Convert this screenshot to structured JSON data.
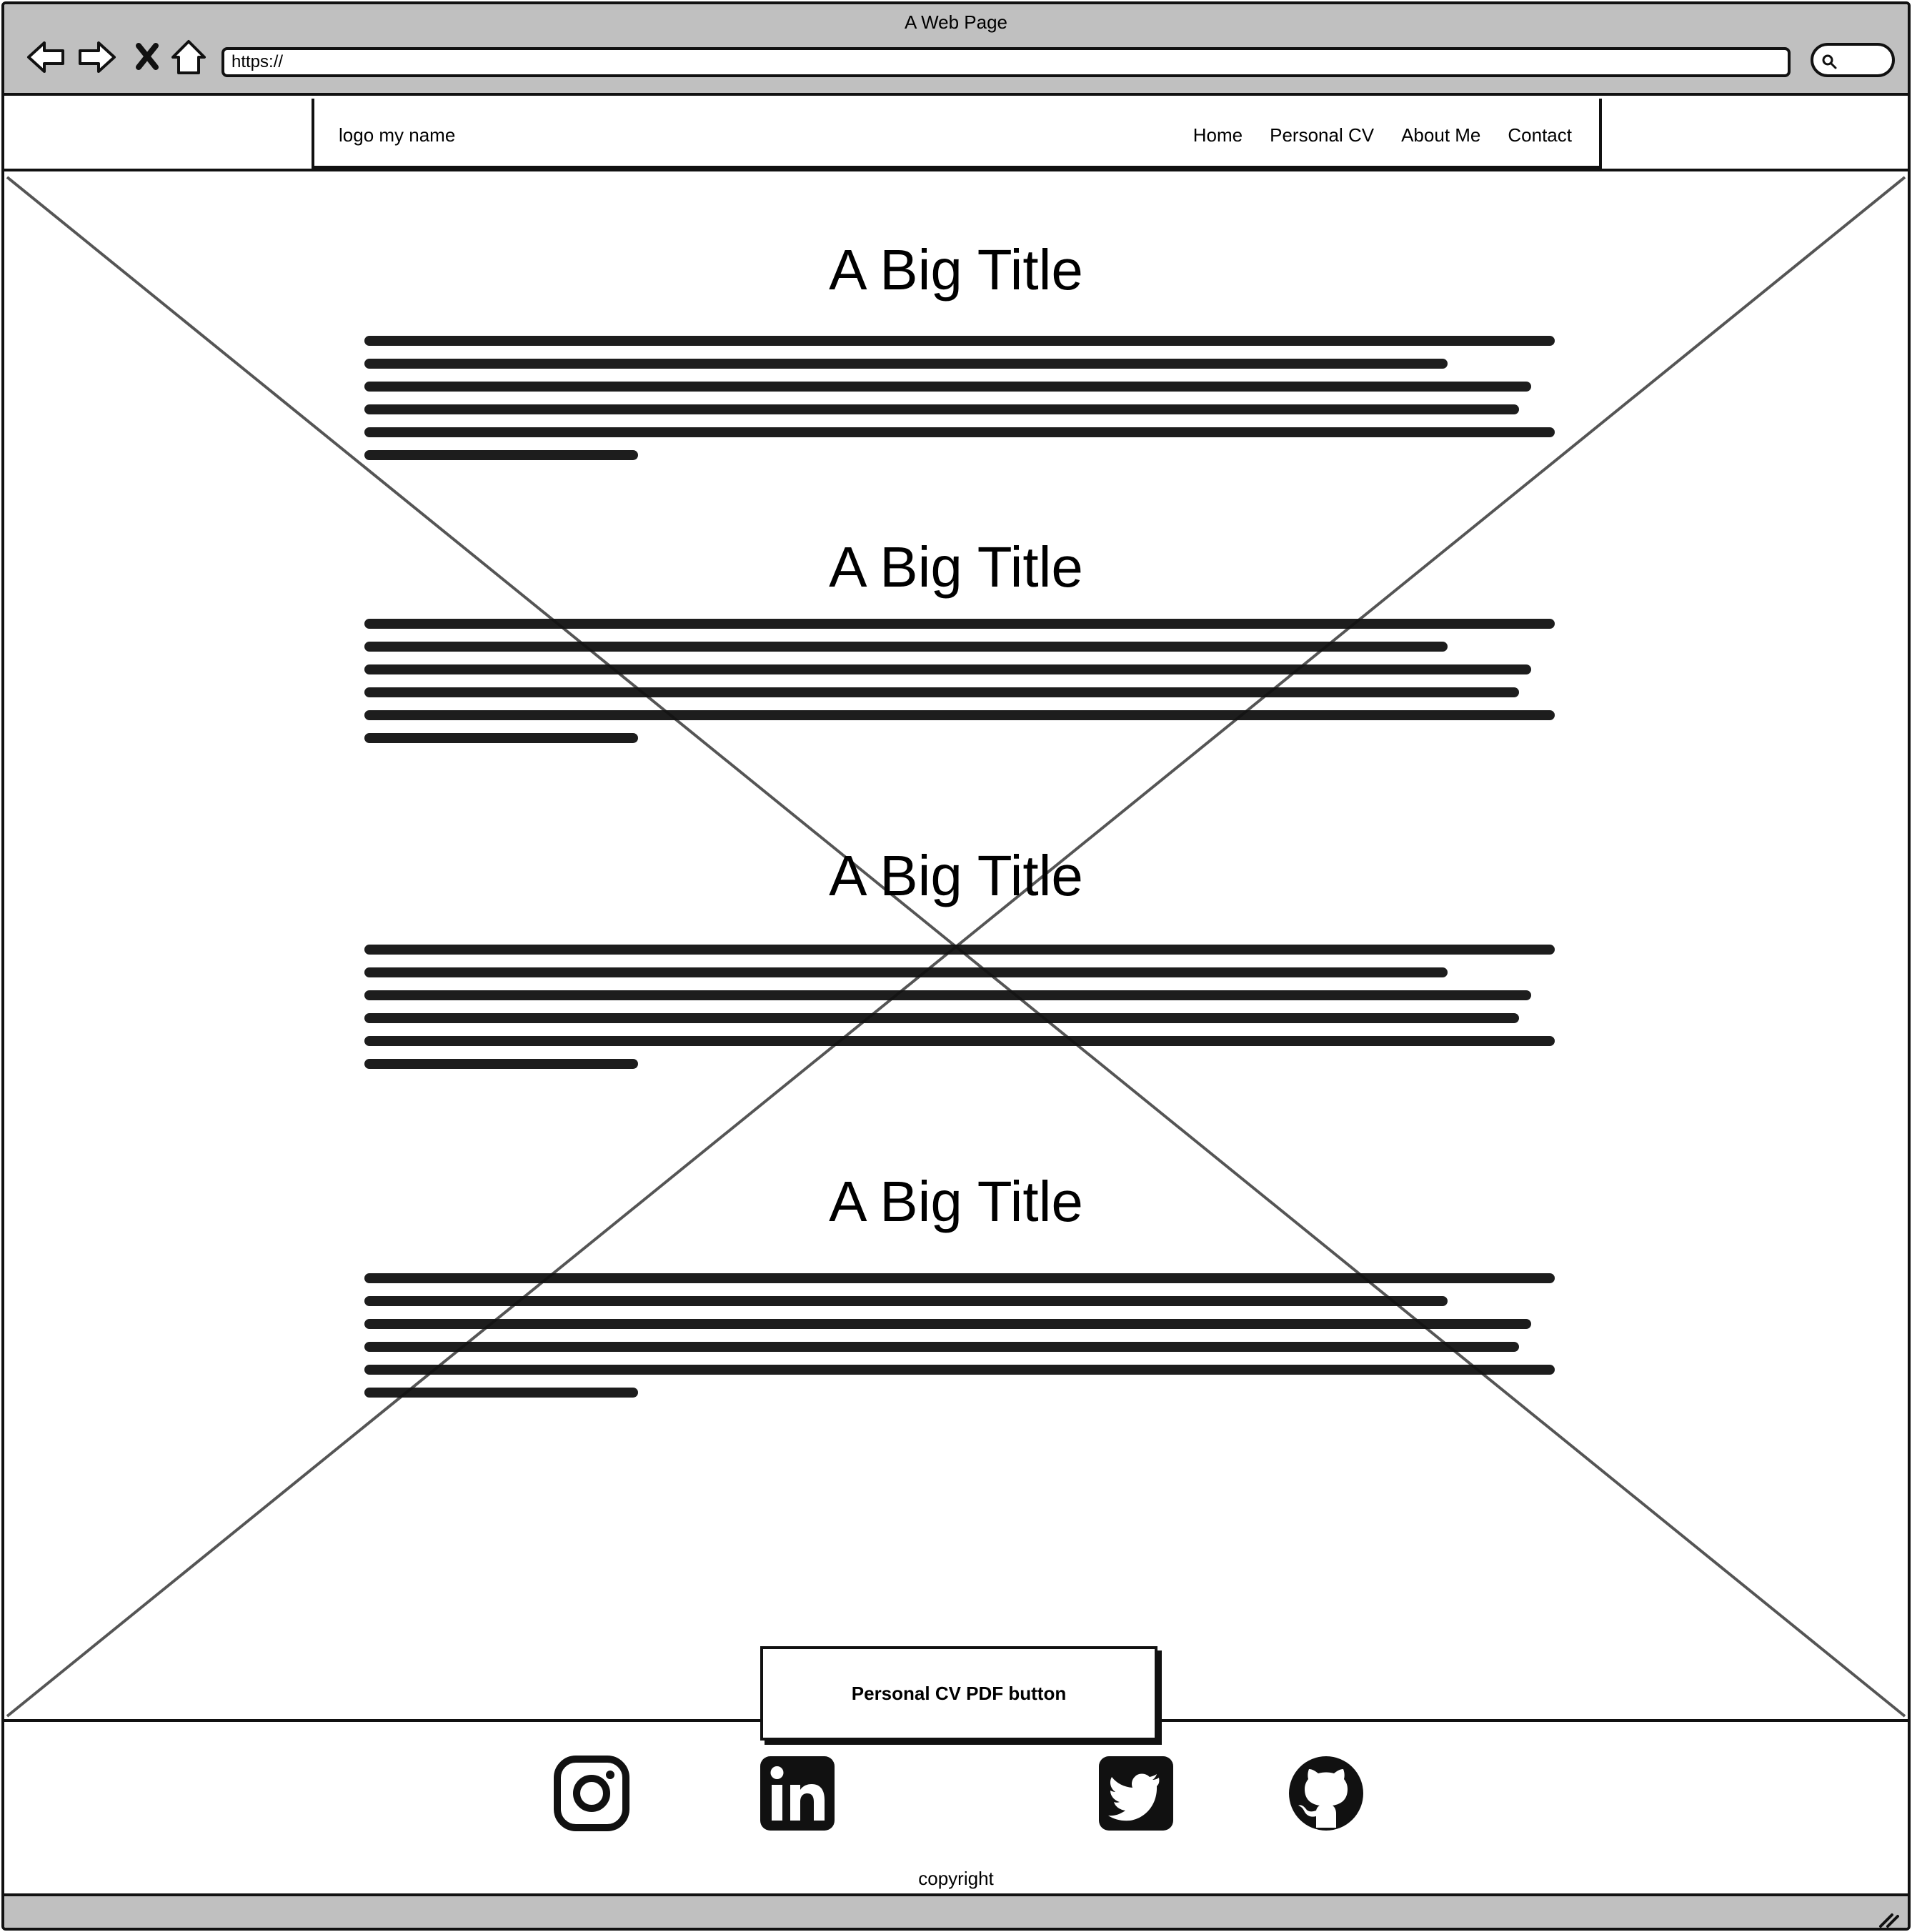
{
  "window": {
    "title": "A Web Page"
  },
  "browser": {
    "url": "https://"
  },
  "header": {
    "logo": "logo my name",
    "nav": [
      "Home",
      "Personal CV",
      "About Me",
      "Contact"
    ]
  },
  "sections": [
    {
      "title": "A Big Title"
    },
    {
      "title": "A Big Title"
    },
    {
      "title": "A Big Title"
    },
    {
      "title": "A Big Title"
    }
  ],
  "cv_button": {
    "label": "Personal CV PDF button"
  },
  "footer": {
    "socials": [
      "instagram-icon",
      "linkedin-icon",
      "twitter-icon",
      "github-icon"
    ],
    "copyright": "copyright"
  }
}
